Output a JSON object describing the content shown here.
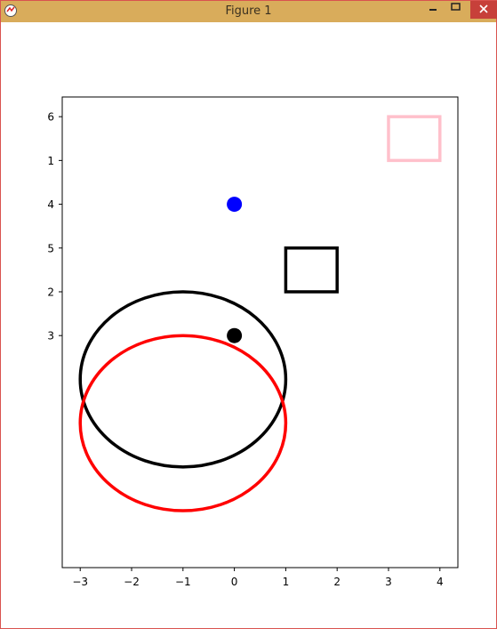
{
  "window": {
    "title": "Figure 1",
    "colors": {
      "titlebar": "#d9ac5b",
      "close": "#c7403a",
      "border": "#d9534f"
    }
  },
  "chart_data": {
    "type": "scatter",
    "title": "",
    "xlabel": "",
    "ylabel": "",
    "xlim": [
      -3.35,
      4.35
    ],
    "ylim": [
      -4.3,
      6.45
    ],
    "x_ticks": [
      {
        "value": -3,
        "label": "−3"
      },
      {
        "value": -2,
        "label": "−2"
      },
      {
        "value": -1,
        "label": "−1"
      },
      {
        "value": 0,
        "label": "0"
      },
      {
        "value": 1,
        "label": "1"
      },
      {
        "value": 2,
        "label": "2"
      },
      {
        "value": 3,
        "label": "3"
      },
      {
        "value": 4,
        "label": "4"
      }
    ],
    "y_ticks": [
      {
        "value": 6,
        "label": "6"
      },
      {
        "value": 5,
        "label": "1"
      },
      {
        "value": 4,
        "label": "4"
      },
      {
        "value": 3,
        "label": "5"
      },
      {
        "value": 2,
        "label": "2"
      },
      {
        "value": 1,
        "label": "3"
      }
    ],
    "grid": false,
    "shapes": [
      {
        "kind": "circle",
        "name": "black-circle",
        "center": [
          -1,
          0
        ],
        "radius": 2,
        "color": "#000000"
      },
      {
        "kind": "circle",
        "name": "red-circle",
        "center": [
          -1,
          -1
        ],
        "radius": 2,
        "color": "#ff0000"
      },
      {
        "kind": "rectangle",
        "name": "black-square",
        "x": 1,
        "y": 2,
        "width": 1,
        "height": 1,
        "color": "#000000"
      },
      {
        "kind": "rectangle",
        "name": "pink-square",
        "x": 3,
        "y": 5,
        "width": 1,
        "height": 1,
        "color": "#ffc0cb"
      }
    ],
    "points": [
      {
        "name": "blue-point",
        "x": 0,
        "y": 4,
        "color": "#0000ff"
      },
      {
        "name": "black-point",
        "x": 0,
        "y": 1,
        "color": "#000000"
      }
    ]
  }
}
